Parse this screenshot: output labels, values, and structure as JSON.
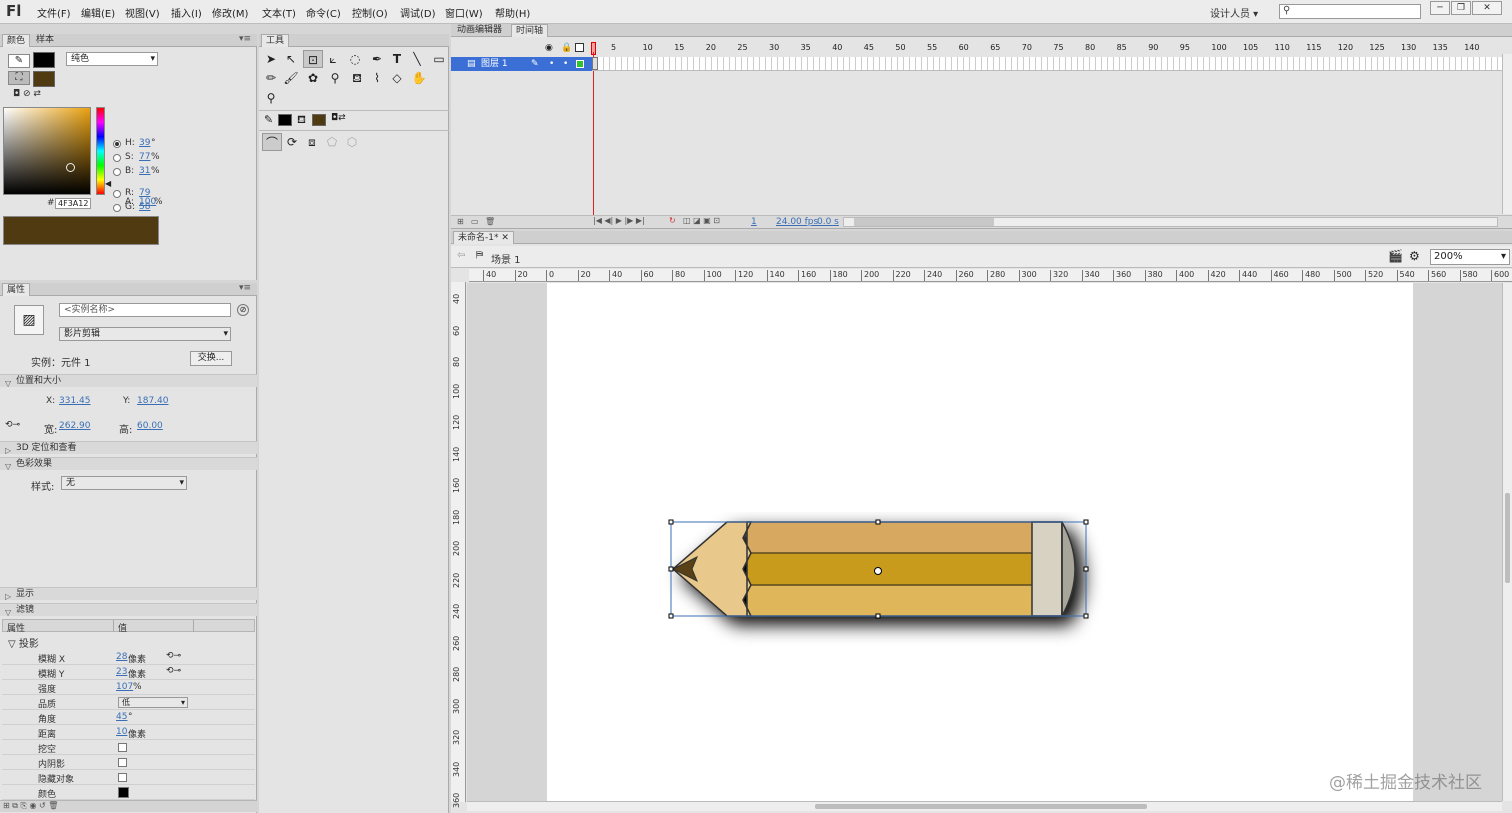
{
  "app": {
    "logo": "Fl",
    "workspace": "设计人员",
    "search_placeholder": ""
  },
  "menu": [
    "文件(F)",
    "编辑(E)",
    "视图(V)",
    "插入(I)",
    "修改(M)",
    "文本(T)",
    "命令(C)",
    "控制(O)",
    "调试(D)",
    "窗口(W)",
    "帮助(H)"
  ],
  "color_panel": {
    "tabs": [
      "颜色",
      "样本"
    ],
    "fill_type": "纯色",
    "hsb": [
      {
        "k": "H:",
        "v": "39",
        "u": "°"
      },
      {
        "k": "S:",
        "v": "77",
        "u": "%"
      },
      {
        "k": "B:",
        "v": "31",
        "u": "%"
      }
    ],
    "rgb": [
      {
        "k": "R:",
        "v": "79"
      },
      {
        "k": "G:",
        "v": "58"
      },
      {
        "k": "B:",
        "v": "18"
      }
    ],
    "alpha": {
      "k": "A:",
      "v": "100",
      "u": "%"
    },
    "hex_label": "#",
    "hex": "4F3A12",
    "swatch_color": "#4F3A12"
  },
  "tools_panel": {
    "title": "工具"
  },
  "properties": {
    "tab": "属性",
    "instance_name_placeholder": "<实例名称>",
    "instance_type": "影片剪辑",
    "instance_label": "实例：",
    "instance_value": "元件 1",
    "swap_button": "交换...",
    "sections": {
      "pos_size": "位置和大小",
      "pos3d": "3D 定位和查看",
      "color_effect": "色彩效果",
      "display": "显示",
      "filters": "滤镜"
    },
    "x_label": "X:",
    "x": "331.45",
    "y_label": "Y:",
    "y": "187.40",
    "w_label": "宽:",
    "w": "262.90",
    "h_label": "高:",
    "h": "60.00",
    "style_label": "样式:",
    "style_value": "无",
    "filter_table": {
      "header": [
        "属性",
        "值"
      ],
      "group": "投影",
      "rows": [
        {
          "name": "模糊 X",
          "value": "28",
          "unit": "像素",
          "link": true
        },
        {
          "name": "模糊 Y",
          "value": "23",
          "unit": "像素",
          "link": true
        },
        {
          "name": "强度",
          "value": "107",
          "unit": "%"
        },
        {
          "name": "品质",
          "value": "低",
          "select": true
        },
        {
          "name": "角度",
          "value": "45",
          "unit": "°"
        },
        {
          "name": "距离",
          "value": "10",
          "unit": "像素"
        },
        {
          "name": "挖空",
          "check": true
        },
        {
          "name": "内阴影",
          "check": true
        },
        {
          "name": "隐藏对象",
          "check": true
        },
        {
          "name": "颜色",
          "color": "#000000"
        }
      ]
    }
  },
  "timeline": {
    "tabs": [
      "动画编辑器",
      "时间轴"
    ],
    "layer": "图层 1",
    "frame_numbers": [
      "5",
      "10",
      "15",
      "20",
      "25",
      "30",
      "35",
      "40",
      "45",
      "50",
      "55",
      "60",
      "65",
      "70",
      "75",
      "80",
      "85",
      "90",
      "95",
      "100",
      "105",
      "110",
      "115",
      "120",
      "125",
      "130",
      "135",
      "140"
    ],
    "current_frame": "1",
    "fps": "24.00 fps",
    "time": "0.0 s",
    "playhead_label": "1"
  },
  "document": {
    "tab": "未命名-1*",
    "scene": "场景 1",
    "zoom": "200%",
    "h_ruler": [
      "40",
      "20",
      "0",
      "20",
      "40",
      "60",
      "80",
      "100",
      "120",
      "140",
      "160",
      "180",
      "200",
      "220",
      "240",
      "260",
      "280",
      "300",
      "320",
      "340",
      "360",
      "380",
      "400",
      "420",
      "440",
      "460",
      "480",
      "500",
      "520",
      "540",
      "560",
      "580",
      "600"
    ],
    "v_ruler": [
      "40",
      "60",
      "80",
      "100",
      "120",
      "140",
      "160",
      "180",
      "200",
      "220",
      "240",
      "260",
      "280",
      "300",
      "320",
      "340",
      "360"
    ]
  },
  "watermark": "@稀土掘金技术社区"
}
